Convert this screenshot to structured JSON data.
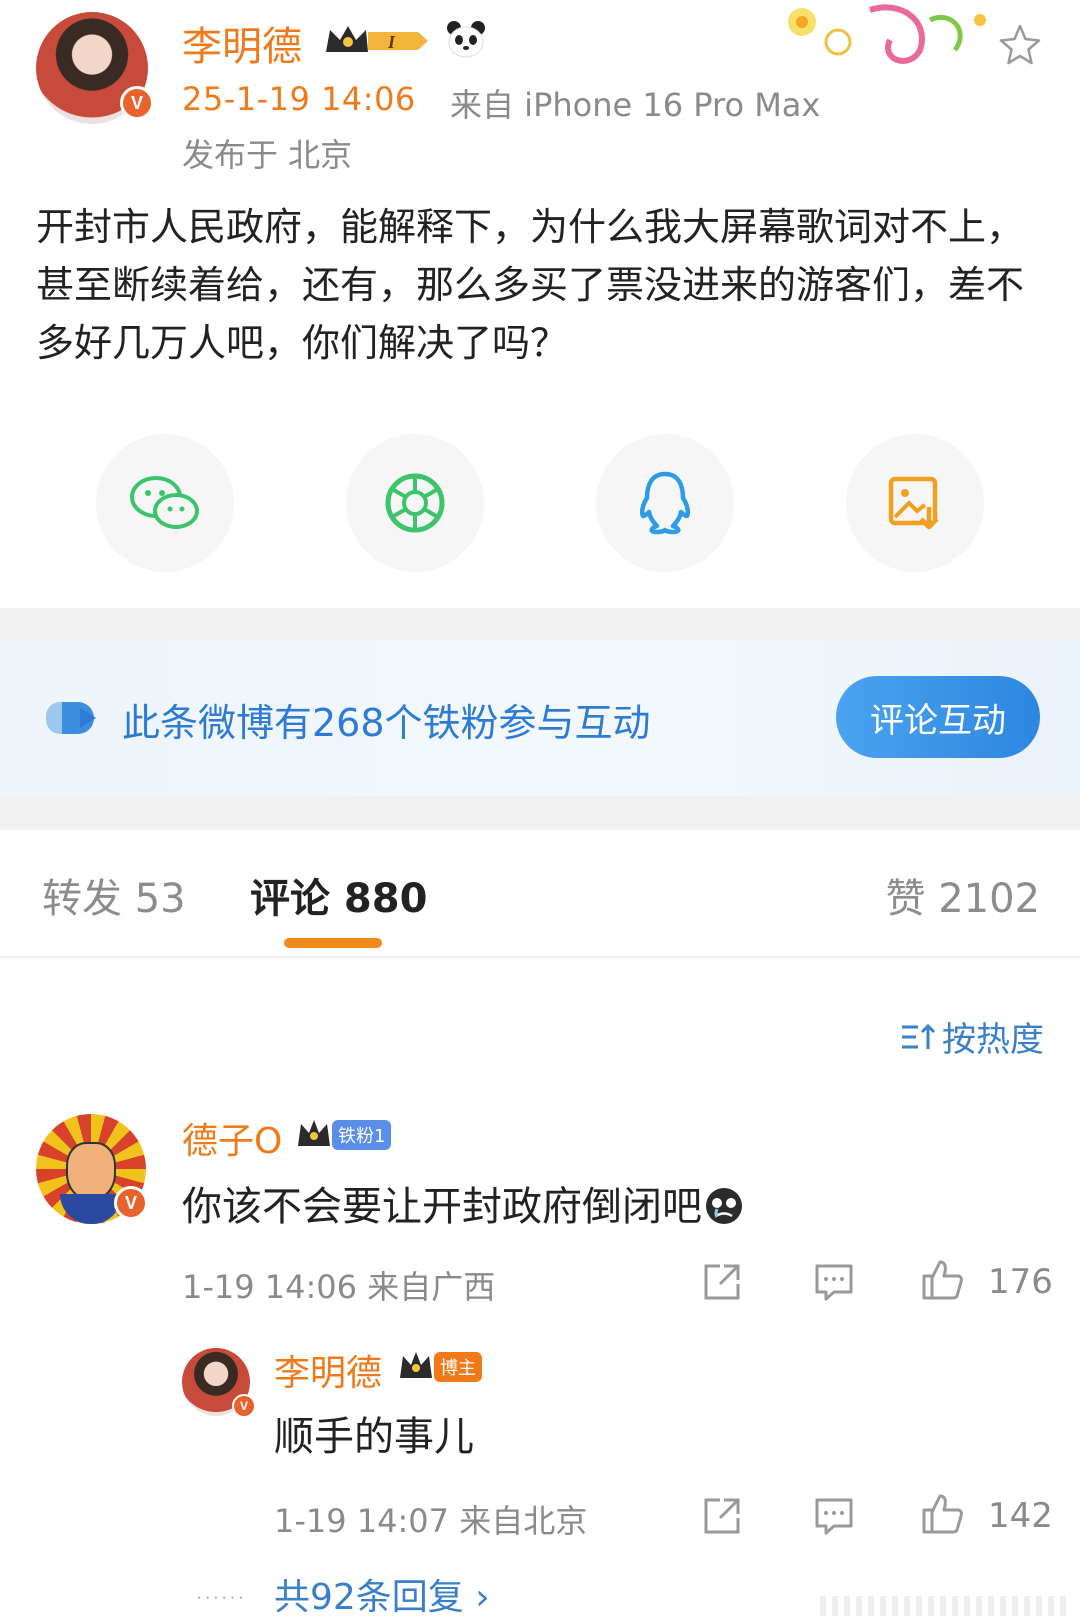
{
  "post": {
    "author": "李明德",
    "time": "25-1-19 14:06",
    "source": "来自 iPhone 16 Pro Max",
    "location": "发布于 北京",
    "text": "开封市人民政府，能解释下，为什么我大屏幕歌词对不上，甚至断续着给，还有，那么多买了票没进来的游客们，差不多好几万人吧，你们解决了吗？",
    "badge_level": "I"
  },
  "share_buttons": [
    {
      "icon": "wechat-icon",
      "color": "#3cc46a"
    },
    {
      "icon": "moments-icon",
      "color": "#3cc46a"
    },
    {
      "icon": "qq-icon",
      "color": "#2d9be8"
    },
    {
      "icon": "save-image-icon",
      "color": "#f0a020"
    }
  ],
  "fan_banner": {
    "text": "此条微博有268个铁粉参与互动",
    "button": "评论互动"
  },
  "tabs": {
    "repost": "转发 53",
    "comments": "评论 880",
    "likes": "赞 2102"
  },
  "sort": {
    "label": "按热度"
  },
  "comments": [
    {
      "name": "德子O",
      "tag": "铁粉1",
      "text": "你该不会要让开封政府倒闭吧",
      "meta": "1-19 14:06 来自广西",
      "likes": "176",
      "tag_color": "#5b8ee8"
    },
    {
      "name": "李明德",
      "tag": "博主",
      "text": "顺手的事儿",
      "meta": "1-19 14:07 来自北京",
      "likes": "142",
      "tag_color": "#f07a1a"
    }
  ],
  "more_replies": "共92条回复 ›",
  "colors": {
    "accent_orange": "#f07a1a",
    "link_blue": "#3a7fc8"
  }
}
